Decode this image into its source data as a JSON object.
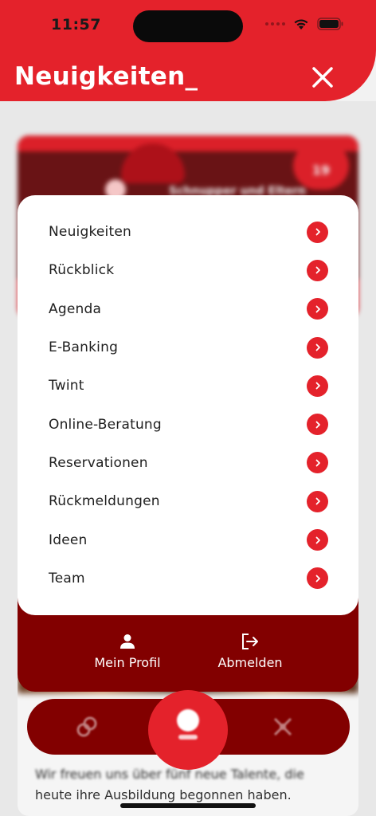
{
  "status_bar": {
    "time": "11:57"
  },
  "header": {
    "title": "Neuigkeiten_"
  },
  "menu": {
    "items": [
      {
        "label": "Neuigkeiten"
      },
      {
        "label": "Rückblick"
      },
      {
        "label": "Agenda"
      },
      {
        "label": "E-Banking"
      },
      {
        "label": "Twint"
      },
      {
        "label": "Online-Beratung"
      },
      {
        "label": "Reservationen"
      },
      {
        "label": "Rückmeldungen"
      },
      {
        "label": "Ideen"
      },
      {
        "label": "Team"
      }
    ]
  },
  "footer": {
    "profile_label": "Mein Profil",
    "logout_label": "Abmelden"
  },
  "background": {
    "badge_text": "19",
    "card_title": "Schnupper und Eltern",
    "text_line_1": "Wir freuen uns über fünf neue Talente, die",
    "text_line_2": "heute ihre Ausbildung begonnen haben."
  },
  "colors": {
    "accent": "#e4222b",
    "dark_accent": "#820000",
    "background": "#f2f2f2"
  },
  "icons": {
    "close": "close-icon",
    "chevron": "chevron-right-icon",
    "profile": "person-icon",
    "logout": "logout-icon"
  }
}
